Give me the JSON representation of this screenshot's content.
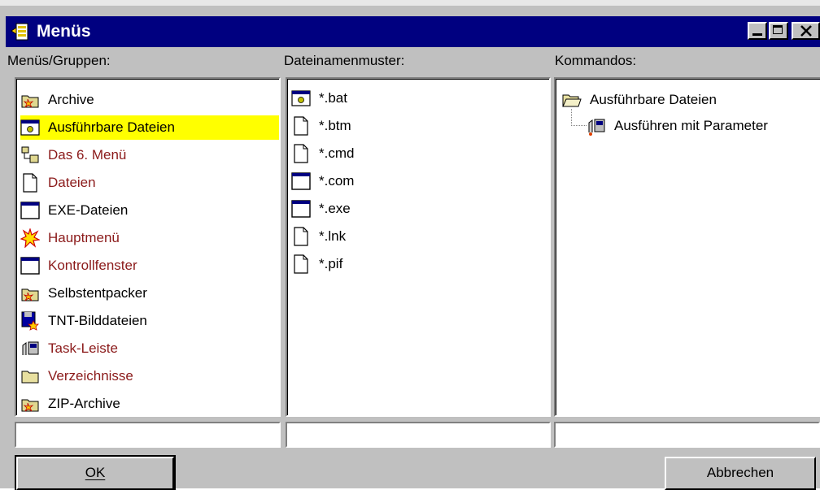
{
  "window": {
    "title": "Menüs"
  },
  "columns": {
    "groups_label": "Menüs/Gruppen:",
    "patterns_label": "Dateinamenmuster:",
    "commands_label": "Kommandos:"
  },
  "groups": [
    {
      "label": "Archive",
      "icon": "archive-folder-icon",
      "color": "black"
    },
    {
      "label": "Ausführbare Dateien",
      "icon": "batch-window-icon",
      "color": "black",
      "selected": true
    },
    {
      "label": "Das 6. Menü",
      "icon": "menu-tree-icon",
      "color": "red"
    },
    {
      "label": "Dateien",
      "icon": "document-icon",
      "color": "red"
    },
    {
      "label": "EXE-Dateien",
      "icon": "window-icon",
      "color": "black"
    },
    {
      "label": "Hauptmenü",
      "icon": "star-burst-icon",
      "color": "red"
    },
    {
      "label": "Kontrollfenster",
      "icon": "window-icon",
      "color": "red"
    },
    {
      "label": "Selbstentpacker",
      "icon": "archive-folder-icon",
      "color": "black"
    },
    {
      "label": "TNT-Bilddateien",
      "icon": "floppy-star-icon",
      "color": "black"
    },
    {
      "label": "Task-Leiste",
      "icon": "run-parameter-icon",
      "color": "red"
    },
    {
      "label": "Verzeichnisse",
      "icon": "folder-icon",
      "color": "red"
    },
    {
      "label": "ZIP-Archive",
      "icon": "archive-folder-icon",
      "color": "black"
    }
  ],
  "patterns": [
    {
      "label": "*.bat",
      "icon": "batch-window-icon"
    },
    {
      "label": "*.btm",
      "icon": "document-icon"
    },
    {
      "label": "*.cmd",
      "icon": "document-icon"
    },
    {
      "label": "*.com",
      "icon": "window-icon"
    },
    {
      "label": "*.exe",
      "icon": "window-icon"
    },
    {
      "label": "*.lnk",
      "icon": "document-icon"
    },
    {
      "label": "*.pif",
      "icon": "document-icon"
    }
  ],
  "commands": {
    "root": {
      "label": "Ausführbare Dateien",
      "icon": "open-folder-icon"
    },
    "children": [
      {
        "label": "Ausführen mit Parameter",
        "icon": "run-parameter-icon"
      }
    ]
  },
  "buttons": {
    "ok": "OK",
    "cancel": "Abbrechen"
  },
  "colors": {
    "titlebar": "#000080",
    "selection": "#ffff00",
    "red_text": "#8b1a1a",
    "face": "#c0c0c0"
  }
}
